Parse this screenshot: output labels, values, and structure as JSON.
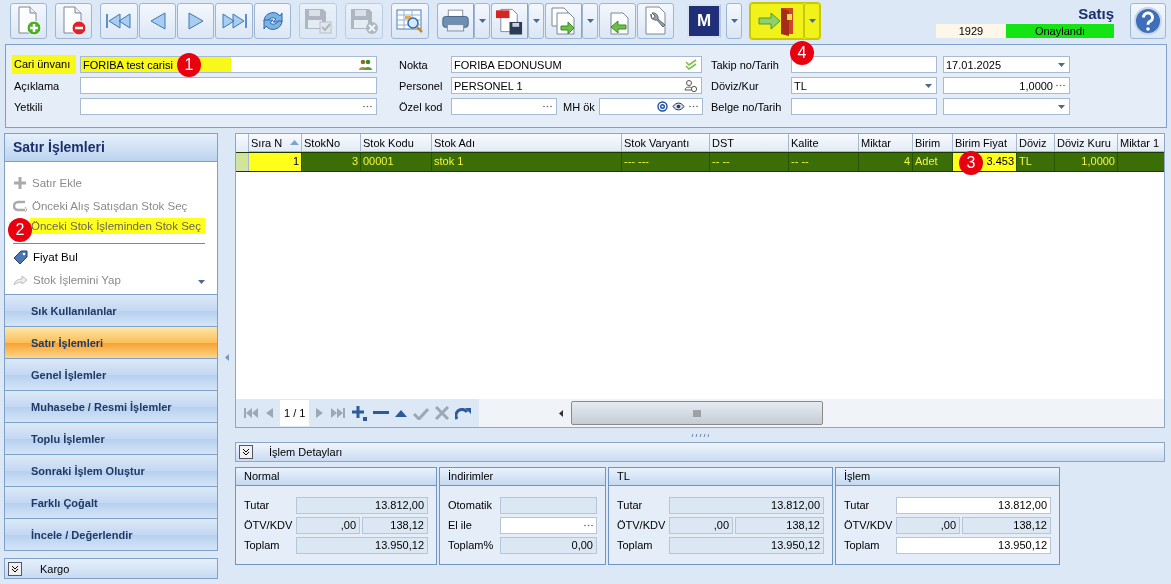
{
  "toolbar_groups": [
    [
      {
        "kind": "new",
        "disabled": false,
        "dropdown": false,
        "highlighted": false
      }
    ],
    [
      {
        "kind": "delete",
        "disabled": false,
        "dropdown": false,
        "highlighted": false
      }
    ],
    [
      {
        "kind": "first",
        "disabled": false,
        "dropdown": false,
        "highlighted": false
      },
      {
        "kind": "prev",
        "disabled": false,
        "dropdown": false,
        "highlighted": false
      },
      {
        "kind": "next",
        "disabled": false,
        "dropdown": false,
        "highlighted": false
      },
      {
        "kind": "last",
        "disabled": false,
        "dropdown": false,
        "highlighted": false
      },
      {
        "kind": "refresh",
        "disabled": false,
        "dropdown": false,
        "highlighted": false
      }
    ],
    [
      {
        "kind": "save",
        "disabled": true,
        "dropdown": false,
        "highlighted": false
      }
    ],
    [
      {
        "kind": "cancel",
        "disabled": true,
        "dropdown": false,
        "highlighted": false
      }
    ],
    [
      {
        "kind": "preview",
        "disabled": false,
        "dropdown": false,
        "highlighted": false
      }
    ],
    [
      {
        "kind": "print",
        "disabled": false,
        "dropdown": true,
        "highlighted": false
      },
      {
        "kind": "pdf",
        "disabled": false,
        "dropdown": true,
        "highlighted": false
      },
      {
        "kind": "copy",
        "disabled": false,
        "dropdown": true,
        "highlighted": false
      },
      {
        "kind": "import",
        "disabled": false,
        "dropdown": false,
        "highlighted": false
      },
      {
        "kind": "tools",
        "disabled": false,
        "dropdown": false,
        "highlighted": false
      }
    ],
    [
      {
        "kind": "letter",
        "label": "M",
        "disabled": false,
        "dropdown": true,
        "highlighted": false
      }
    ],
    [
      {
        "kind": "exit",
        "disabled": false,
        "dropdown": true,
        "highlighted": true,
        "callout": "4"
      }
    ]
  ],
  "header": {
    "title": "Satış",
    "number": "1929",
    "status": "Onaylandı"
  },
  "form_columns": [
    [
      {
        "label": "Cari ünvanı",
        "highlighted": true,
        "fields": [
          {
            "value": "FORIBA  test carisi",
            "kind": "people",
            "callout": "1"
          }
        ]
      },
      {
        "label": "Açıklama",
        "highlighted": false,
        "fields": [
          {
            "kind": "text"
          }
        ]
      },
      {
        "label": "Yetkili",
        "highlighted": false,
        "fields": [
          {
            "kind": "ellipsis"
          }
        ]
      }
    ],
    [
      {
        "label": "Nokta",
        "highlighted": false,
        "fields": [
          {
            "value": "FORIBA EDONUSUM",
            "kind": "check"
          }
        ]
      },
      {
        "label": "Personel",
        "highlighted": false,
        "fields": [
          {
            "value": "PERSONEL  1",
            "kind": "person"
          }
        ]
      },
      {
        "label": "Özel kod",
        "highlighted": false,
        "fields": [
          {
            "kind": "ellipsis"
          },
          {
            "label": "MH ök",
            "kind": "mail"
          }
        ]
      }
    ],
    [
      {
        "label": "Takip no/Tarih",
        "highlighted": false,
        "fields": [
          {
            "kind": "text"
          },
          {
            "value": "17.01.2025",
            "kind": "dropdown"
          }
        ]
      },
      {
        "label": "Döviz/Kur",
        "highlighted": false,
        "fields": [
          {
            "value": "TL",
            "kind": "dropdown"
          },
          {
            "value": "1,0000",
            "kind": "number"
          }
        ]
      },
      {
        "label": "Belge no/Tarih",
        "highlighted": false,
        "fields": [
          {
            "kind": "text"
          },
          {
            "kind": "dropdown"
          }
        ]
      }
    ]
  ],
  "side_panel": {
    "title": "Satır İşlemleri",
    "actions": [
      {
        "label": "Satır Ekle",
        "kind": "plus",
        "disabled": true,
        "highlighted": false,
        "dropdown": false
      },
      {
        "label": "Önceki Alış Satışdan Stok Seç",
        "kind": "return",
        "disabled": true,
        "highlighted": false,
        "dropdown": false
      },
      {
        "label": "Önceki Stok İşleminden Stok Seç",
        "kind": "none",
        "disabled": true,
        "highlighted": true,
        "dropdown": false,
        "callout": "2"
      },
      {
        "label": "Fiyat Bul",
        "kind": "tag",
        "disabled": false,
        "highlighted": false,
        "dropdown": false
      },
      {
        "label": "Stok İşlemini Yap",
        "kind": "share",
        "disabled": true,
        "highlighted": false,
        "dropdown": true
      }
    ],
    "groups": [
      {
        "label": "Sık Kullanılanlar",
        "selected": false
      },
      {
        "label": "Satır İşlemleri",
        "selected": true
      },
      {
        "label": "Genel İşlemler",
        "selected": false
      },
      {
        "label": "Muhasebe / Resmi İşlemler",
        "selected": false
      },
      {
        "label": "Toplu İşlemler",
        "selected": false
      },
      {
        "label": "Sonraki İşlem Oluştur",
        "selected": false
      },
      {
        "label": "Farklı Çoğalt",
        "selected": false
      },
      {
        "label": "İncele / Değerlendir",
        "selected": false
      }
    ],
    "footer": "Kargo"
  },
  "table": {
    "columns": [
      {
        "label": "Sıra N",
        "kind": "number",
        "sorted": true
      },
      {
        "label": "StokNo",
        "kind": "number",
        "sorted": false
      },
      {
        "label": "Stok Kodu",
        "kind": "text",
        "sorted": false
      },
      {
        "label": "Stok Adı",
        "kind": "text",
        "sorted": false
      },
      {
        "label": "Stok Varyantı",
        "kind": "text",
        "sorted": false
      },
      {
        "label": "DST",
        "kind": "text",
        "sorted": false
      },
      {
        "label": "Kalite",
        "kind": "text",
        "sorted": false
      },
      {
        "label": "Miktar",
        "kind": "number",
        "sorted": false
      },
      {
        "label": "Birim",
        "kind": "text",
        "sorted": false
      },
      {
        "label": "Birim Fiyat",
        "kind": "number",
        "sorted": false
      },
      {
        "label": "Döviz",
        "kind": "text",
        "sorted": false
      },
      {
        "label": "Döviz Kuru",
        "kind": "number",
        "sorted": false
      },
      {
        "label": "Miktar 1",
        "sorted": false
      }
    ],
    "rows": [
      {
        "selected": true,
        "cells": [
          {
            "text": "1",
            "highlighted": true
          },
          {
            "text": "3",
            "highlighted": false
          },
          {
            "text": "00001",
            "highlighted": false
          },
          {
            "text": "stok 1",
            "highlighted": false
          },
          {
            "text": "--- ---",
            "highlighted": false
          },
          {
            "text": "-- --",
            "highlighted": false
          },
          {
            "text": "-- --",
            "highlighted": false
          },
          {
            "text": "4",
            "highlighted": false
          },
          {
            "text": "Adet",
            "highlighted": false
          },
          {
            "text": "3.453",
            "highlighted": true,
            "callout": "3"
          },
          {
            "text": "TL",
            "highlighted": false
          },
          {
            "text": "1,0000",
            "highlighted": false
          }
        ]
      }
    ],
    "pager": "1 / 1"
  },
  "details": {
    "title": "İşlem Detayları",
    "groups": [
      {
        "title": "Normal",
        "rows": [
          {
            "label": "Tutar",
            "fields": [
              {
                "value": "13.812,00",
                "editable": false
              }
            ]
          },
          {
            "label": "ÖTV/KDV",
            "fields": [
              {
                "value": ",00",
                "editable": false
              },
              {
                "value": "138,12",
                "editable": false
              }
            ]
          },
          {
            "label": "Toplam",
            "fields": [
              {
                "value": "13.950,12",
                "editable": false
              }
            ]
          }
        ]
      },
      {
        "title": "İndirimler",
        "rows": [
          {
            "label": "Otomatik",
            "fields": [
              {
                "editable": false
              }
            ]
          },
          {
            "label": "El ile",
            "fields": [
              {
                "editable": true,
                "kind": "ellipsis"
              }
            ]
          },
          {
            "label": "Toplam%",
            "fields": [
              {
                "value": "0,00",
                "editable": false
              }
            ]
          }
        ]
      },
      {
        "title": "TL",
        "rows": [
          {
            "label": "Tutar",
            "fields": [
              {
                "value": "13.812,00",
                "editable": false
              }
            ]
          },
          {
            "label": "ÖTV/KDV",
            "fields": [
              {
                "value": ",00",
                "editable": false
              },
              {
                "value": "138,12",
                "editable": false
              }
            ]
          },
          {
            "label": "Toplam",
            "fields": [
              {
                "value": "13.950,12",
                "editable": false
              }
            ]
          }
        ]
      },
      {
        "title": "İşlem",
        "rows": [
          {
            "label": "Tutar",
            "fields": [
              {
                "value": "13.812,00",
                "editable": true
              }
            ]
          },
          {
            "label": "ÖTV/KDV",
            "fields": [
              {
                "value": ",00",
                "editable": false
              },
              {
                "value": "138,12",
                "editable": false
              }
            ]
          },
          {
            "label": "Toplam",
            "fields": [
              {
                "value": "13.950,12",
                "editable": true
              }
            ]
          }
        ]
      }
    ]
  }
}
